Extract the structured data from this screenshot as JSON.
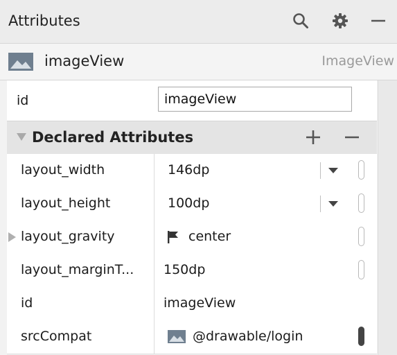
{
  "header": {
    "title": "Attributes",
    "search_icon": "search-icon",
    "settings_icon": "gear-icon",
    "minimize_icon": "minimize-icon"
  },
  "component": {
    "icon": "image-icon",
    "name": "imageView",
    "type": "ImageView"
  },
  "id_field": {
    "label": "id",
    "value": "imageView"
  },
  "declared": {
    "title": "Declared Attributes",
    "add_label": "+",
    "remove_label": "−",
    "rows": [
      {
        "name": "layout_width",
        "value": "146dp"
      },
      {
        "name": "layout_height",
        "value": "100dp"
      },
      {
        "name": "layout_gravity",
        "value": "center"
      },
      {
        "name": "layout_marginT...",
        "value": "150dp"
      },
      {
        "name": "id",
        "value": "imageView"
      },
      {
        "name": "srcCompat",
        "value": "@drawable/login"
      }
    ]
  },
  "colors": {
    "header_bg": "#ececec",
    "section_bg": "#e4e4e4",
    "row_bg": "#ffffff",
    "muted_text": "#9a9a9a",
    "image_icon": "#6f7f8f"
  }
}
